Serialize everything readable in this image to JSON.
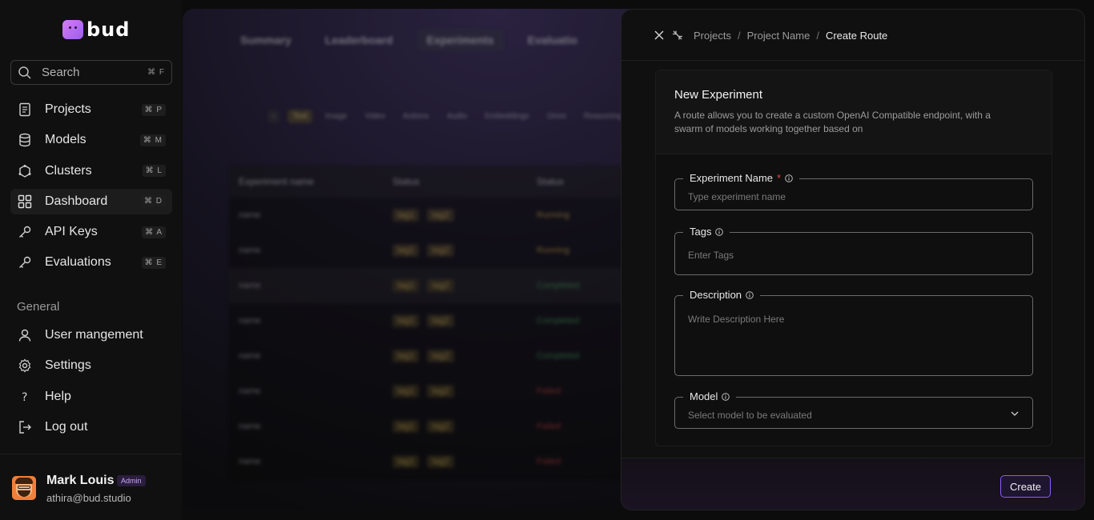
{
  "app": {
    "brand": "bud",
    "accent": "#8b5cf6"
  },
  "sidebar": {
    "search": {
      "label": "Search",
      "shortcut": "⌘ F"
    },
    "items": [
      {
        "label": "Projects",
        "shortcut": "⌘ P",
        "icon": "document-icon"
      },
      {
        "label": "Models",
        "shortcut": "⌘ M",
        "icon": "database-icon"
      },
      {
        "label": "Clusters",
        "shortcut": "⌘ L",
        "icon": "cluster-icon"
      },
      {
        "label": "Dashboard",
        "shortcut": "⌘ D",
        "icon": "grid-icon",
        "active": true
      },
      {
        "label": "API Keys",
        "shortcut": "⌘ A",
        "icon": "key-icon"
      },
      {
        "label": "Evaluations",
        "shortcut": "⌘ E",
        "icon": "key-icon"
      }
    ],
    "section_label": "General",
    "general": [
      {
        "label": "User mangement",
        "icon": "user-icon"
      },
      {
        "label": "Settings",
        "icon": "gear-icon"
      },
      {
        "label": "Help",
        "icon": "help-icon"
      },
      {
        "label": "Log out",
        "icon": "logout-icon"
      }
    ],
    "profile": {
      "name": "Mark Louis",
      "role": "Admin",
      "email": "athira@bud.studio"
    }
  },
  "background": {
    "tabs": [
      "Summary",
      "Leaderboard",
      "Experiments",
      "Evaluatio"
    ],
    "chips": [
      "Text",
      "Image",
      "Video",
      "Actions",
      "Audio",
      "Embeddings",
      "Omni",
      "Reasoning"
    ],
    "columns": [
      "Experiment name",
      "Status",
      "Status"
    ],
    "rows": [
      {
        "name": "name",
        "tags": [
          "tag1",
          "tag2"
        ],
        "status": "Running"
      },
      {
        "name": "name",
        "tags": [
          "tag1",
          "tag2"
        ],
        "status": "Running"
      },
      {
        "name": "name",
        "tags": [
          "tag1",
          "tag2"
        ],
        "status": "Completed"
      },
      {
        "name": "name",
        "tags": [
          "tag1",
          "tag2"
        ],
        "status": "Completed"
      },
      {
        "name": "name",
        "tags": [
          "tag1",
          "tag2"
        ],
        "status": "Completed"
      },
      {
        "name": "name",
        "tags": [
          "tag1",
          "tag2"
        ],
        "status": "Failed"
      },
      {
        "name": "name",
        "tags": [
          "tag1",
          "tag2"
        ],
        "status": "Failed"
      },
      {
        "name": "name",
        "tags": [
          "tag1",
          "tag2"
        ],
        "status": "Failed"
      }
    ]
  },
  "drawer": {
    "breadcrumb": [
      "Projects",
      "Project Name",
      "Create Route"
    ],
    "title": "New Experiment",
    "description": "A route allows you to create a custom OpenAI Compatible endpoint, with a swarm of models working together based on",
    "fields": {
      "name": {
        "label": "Experiment Name",
        "required_mark": "*",
        "placeholder": "Type experiment name"
      },
      "tags": {
        "label": "Tags",
        "placeholder": "Enter Tags"
      },
      "description": {
        "label": "Description",
        "placeholder": "Write Description Here"
      },
      "model": {
        "label": "Model",
        "placeholder": "Select model to be evaluated"
      }
    },
    "create_label": "Create"
  }
}
